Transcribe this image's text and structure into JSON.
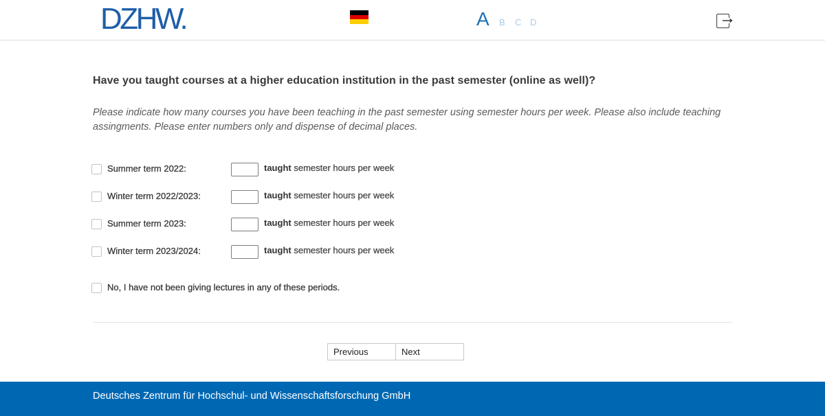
{
  "header": {
    "logo_text": "DZHW.",
    "flag_icon": "german-flag-icon",
    "font_sizes": [
      "A",
      "B",
      "C",
      "D"
    ],
    "logout_icon": "logout-icon"
  },
  "question": {
    "title": "Have you taught courses at a higher education institution in the past semester (online as well)?",
    "instruction": "Please indicate how many courses you have been teaching in the past semester using semester hours per week. Please also include teaching assingments. Please enter numbers only and dispense of decimal places."
  },
  "rows": [
    {
      "label": "Summer term 2022:",
      "checked": false,
      "value": "",
      "suffix_bold": "taught",
      "suffix_rest": "semester hours per week"
    },
    {
      "label": "Winter term 2022/2023:",
      "checked": false,
      "value": "",
      "suffix_bold": "taught",
      "suffix_rest": "semester hours per week"
    },
    {
      "label": "Summer term 2023:",
      "checked": false,
      "value": "",
      "suffix_bold": "taught",
      "suffix_rest": "semester hours per week"
    },
    {
      "label": "Winter term 2023/2024:",
      "checked": false,
      "value": "",
      "suffix_bold": "taught",
      "suffix_rest": "semester hours per week"
    }
  ],
  "none_option": {
    "label": "No, I have not been giving lectures in any of these periods.",
    "checked": false
  },
  "navigation": {
    "previous_label": "Previous",
    "next_label": "Next"
  },
  "footer": {
    "text": "Deutsches Zentrum für Hochschul- und Wissenschaftsforschung GmbH"
  },
  "colors": {
    "brand_blue": "#1f5ea8",
    "footer_background": "#0068b3",
    "font_size_active": "#1f6fb6",
    "font_size_inactive": "#a7cbe8",
    "flag_stripes": [
      "#000000",
      "#dd0000",
      "#ffce00"
    ]
  }
}
